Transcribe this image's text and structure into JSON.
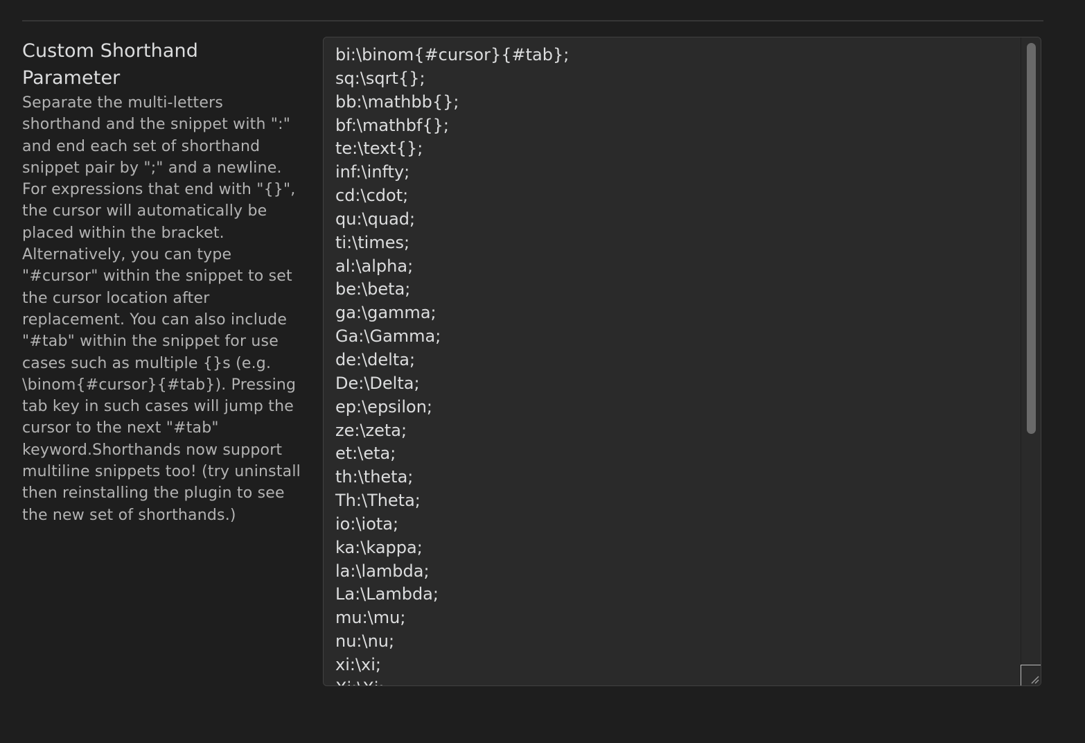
{
  "setting": {
    "name": "Custom Shorthand Parameter",
    "description": "Separate the multi-letters shorthand and the snippet with \":\" and end each set of shorthand snippet pair by \";\" and a newline. For expressions that end with \"{}\", the cursor will automatically be placed within the bracket. Alternatively, you can type \"#cursor\" within the snippet to set the cursor location after replacement. You can also include \"#tab\" within the snippet for use cases such as multiple {}s (e.g. \\binom{#cursor}{#tab}). Pressing tab key in such cases will jump the cursor to the next \"#tab\" keyword.Shorthands now support multiline snippets too! (try uninstall then reinstalling the plugin to see the new set of shorthands.)",
    "value": "bi:\\binom{#cursor}{#tab};\nsq:\\sqrt{};\nbb:\\mathbb{};\nbf:\\mathbf{};\nte:\\text{};\ninf:\\infty;\ncd:\\cdot;\nqu:\\quad;\nti:\\times;\nal:\\alpha;\nbe:\\beta;\nga:\\gamma;\nGa:\\Gamma;\nde:\\delta;\nDe:\\Delta;\nep:\\epsilon;\nze:\\zeta;\net:\\eta;\nth:\\theta;\nTh:\\Theta;\nio:\\iota;\nka:\\kappa;\nla:\\lambda;\nLa:\\Lambda;\nmu:\\mu;\nnu:\\nu;\nxi:\\xi;\nXi:\\Xi;"
  },
  "scrollbar": {
    "position_fraction": 0.0,
    "visible_fraction": 0.6
  },
  "icons": {
    "resize": "resize-grip-icon"
  }
}
